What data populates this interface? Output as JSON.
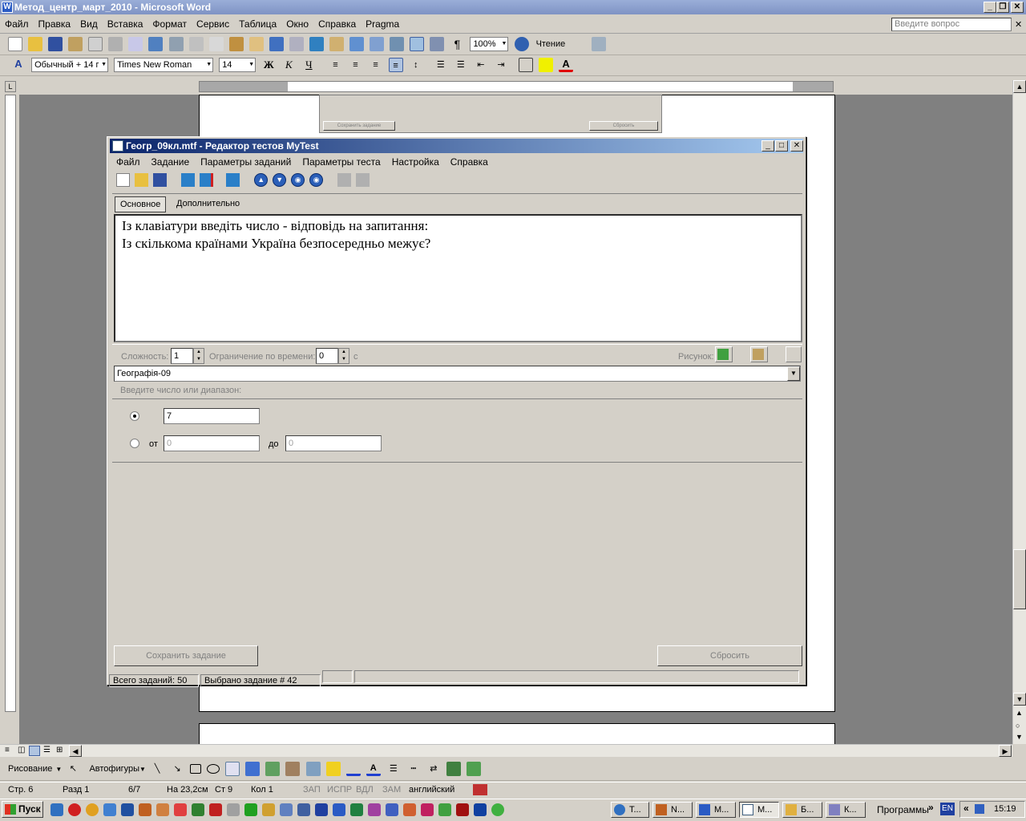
{
  "word": {
    "title": "Метод_центр_март_2010 - Microsoft Word",
    "menu": [
      "Файл",
      "Правка",
      "Вид",
      "Вставка",
      "Формат",
      "Сервис",
      "Таблица",
      "Окно",
      "Справка",
      "Pragma"
    ],
    "ask_placeholder": "Введите вопрос",
    "zoom": "100%",
    "reading_label": "Чтение",
    "style": "Обычный + 14 г",
    "font": "Times New Roman",
    "font_size": "14",
    "status": {
      "page": "Стр. 6",
      "section": "Разд 1",
      "pages": "6/7",
      "pos": "На 23,2см",
      "line": "Ст 9",
      "col": "Кол 1",
      "rec": "ЗАП",
      "trk": "ИСПР",
      "ext": "ВДЛ",
      "ovr": "ЗАМ",
      "lang": "английский"
    },
    "drawing": {
      "draw_label": "Рисование",
      "autoshapes_label": "Автофигуры"
    },
    "bg_buttons": {
      "save": "Сохранить задание",
      "reset": "Сбросить"
    }
  },
  "dialog": {
    "title": "Геогр_09кл.mtf - Редактор тестов MyTest",
    "menu": [
      "Файл",
      "Задание",
      "Параметры заданий",
      "Параметры теста",
      "Настройка",
      "Справка"
    ],
    "tabs": [
      "Основное",
      "Дополнительно"
    ],
    "question_line1": "Із клавіатури введіть число - відповідь на запитання:",
    "question_line2": "Із скількома країнами Україна безпосередньо межує?",
    "complexity_label": "Сложность:",
    "complexity_value": "1",
    "time_label": "Ограничение по времени:",
    "time_value": "0",
    "time_unit": "с",
    "picture_label": "Рисунок:",
    "subject": "Географія-09",
    "range_label": "Введите число или диапазон:",
    "exact_value": "7",
    "from_label": "от",
    "from_value": "0",
    "to_label": "до",
    "to_value": "0",
    "save_button": "Сохранить задание",
    "reset_button": "Сбросить",
    "status_total": "Всего заданий: 50",
    "status_selected": "Выбрано задание # 42"
  },
  "taskbar": {
    "start": "Пуск",
    "tasks": [
      "Т...",
      "N...",
      "М...",
      "М...",
      "Б...",
      "К..."
    ],
    "programs": "Программы",
    "lang": "EN",
    "time": "15:19"
  },
  "colors": {
    "accent": "#0a246a",
    "title_gradient_end": "#a6caf0",
    "workspace": "#808080",
    "chrome": "#d4d0c8"
  }
}
